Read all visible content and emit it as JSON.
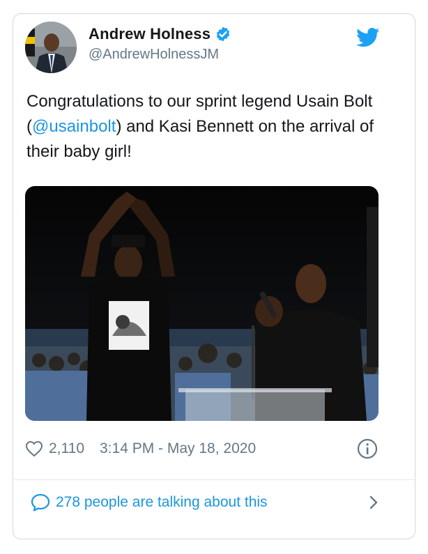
{
  "author": {
    "display_name": "Andrew Holness",
    "handle": "@AndrewHolnessJM",
    "verified": true
  },
  "tweet": {
    "text_before": "Congratulations to our sprint legend Usain Bolt (",
    "mention": "@usainbolt",
    "text_after": ") and Kasi Bennett on the arrival of their baby girl!"
  },
  "meta": {
    "likes": "2,110",
    "timestamp": "3:14 PM - May 18, 2020"
  },
  "conversation": {
    "label": "278 people are talking about this"
  },
  "colors": {
    "link": "#1b95e0",
    "muted": "#657786",
    "border": "#cfd9de"
  },
  "icons": {
    "brand": "twitter-bird-icon",
    "verified": "verified-badge-icon",
    "like": "heart-icon",
    "info": "info-icon",
    "conversation": "speech-bubble-icon",
    "next": "chevron-right-icon"
  }
}
